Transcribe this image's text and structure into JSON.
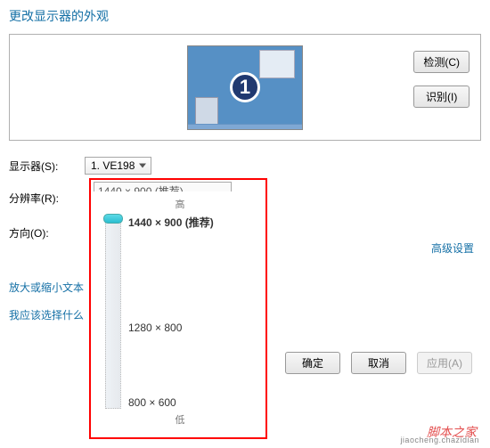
{
  "title": "更改显示器的外观",
  "preview_monitor_number": "1",
  "buttons": {
    "detect": "检测(C)",
    "identify": "识别(I)",
    "ok": "确定",
    "cancel": "取消",
    "apply": "应用(A)"
  },
  "labels": {
    "display": "显示器(S):",
    "resolution": "分辨率(R):",
    "orientation": "方向(O):",
    "high": "高",
    "low": "低",
    "advanced": "高级设置"
  },
  "dropdowns": {
    "display_value": "1. VE198",
    "resolution_value": "1440 × 900 (推荐)"
  },
  "resolution_options": {
    "opt1": "1440 × 900 (推荐)",
    "opt2": "1280 × 800",
    "opt3": "800 × 600"
  },
  "links": {
    "text_size": "放大或缩小文本",
    "what_should": "我应该选择什么"
  },
  "watermark": {
    "main": "脚本之家",
    "sub": "jiaocheng.chazidian"
  }
}
